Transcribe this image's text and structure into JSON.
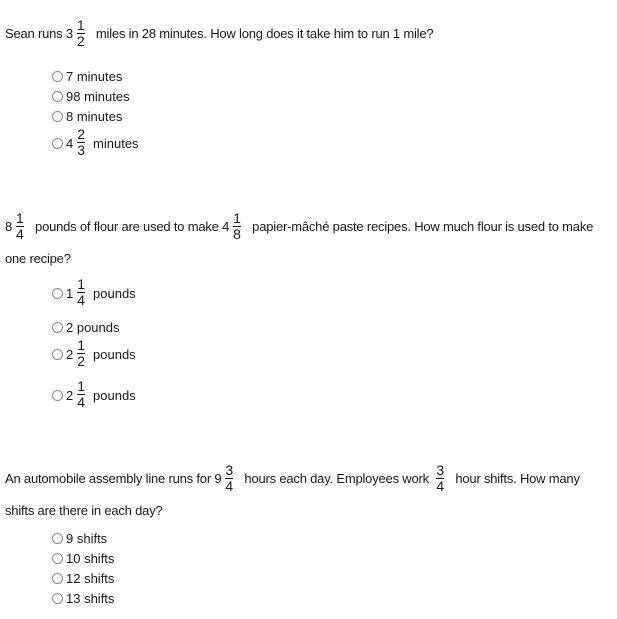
{
  "questions": [
    {
      "id": "q1",
      "text": {
        "before": "Sean runs ",
        "mixed": {
          "whole": "3",
          "num": "1",
          "den": "2"
        },
        "after": " miles in 28 minutes. How long does it take him to run 1 mile?"
      },
      "options": [
        {
          "label": "7 minutes"
        },
        {
          "label": "98 minutes"
        },
        {
          "label": "8 minutes"
        },
        {
          "whole": "4",
          "num": "2",
          "den": "3",
          "unit": "minutes"
        }
      ]
    },
    {
      "id": "q2",
      "text": {
        "mixed1": {
          "whole": "8",
          "num": "1",
          "den": "4"
        },
        "middle": " pounds of flour are used to make ",
        "mixed2": {
          "whole": "4",
          "num": "1",
          "den": "8"
        },
        "after": " papier-mâché paste recipes. How much flour is used to make",
        "line2": "one recipe?"
      },
      "options": [
        {
          "whole": "1",
          "num": "1",
          "den": "4",
          "unit": "pounds"
        },
        {
          "label": "2 pounds"
        },
        {
          "whole": "2",
          "num": "1",
          "den": "2",
          "unit": "pounds"
        },
        {
          "whole": "2",
          "num": "1",
          "den": "4",
          "unit": "pounds"
        }
      ]
    },
    {
      "id": "q3",
      "text": {
        "before": "An automobile assembly line runs for ",
        "mixed": {
          "whole": "9",
          "num": "3",
          "den": "4"
        },
        "middle": " hours each day. Employees work ",
        "frac": {
          "num": "3",
          "den": "4"
        },
        "after": " hour shifts. How many",
        "line2": "shifts are there in each day?"
      },
      "options": [
        {
          "label": "9 shifts"
        },
        {
          "label": "10 shifts"
        },
        {
          "label": "12 shifts"
        },
        {
          "label": "13 shifts"
        }
      ]
    }
  ]
}
